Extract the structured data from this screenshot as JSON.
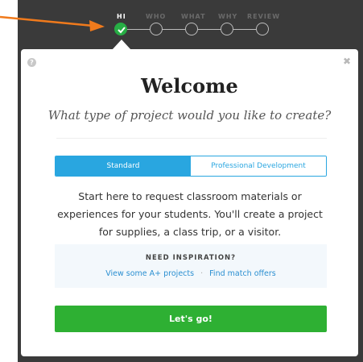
{
  "progress": {
    "steps": [
      {
        "label": "HI",
        "state": "completed"
      },
      {
        "label": "WHO",
        "state": "pending"
      },
      {
        "label": "WHAT",
        "state": "pending"
      },
      {
        "label": "WHY",
        "state": "pending"
      },
      {
        "label": "REVIEW",
        "state": "pending"
      }
    ]
  },
  "modal": {
    "title": "Welcome",
    "subtitle": "What type of project would you like to create?",
    "tabs": [
      {
        "label": "Standard",
        "selected": true
      },
      {
        "label": "Professional Development",
        "selected": false
      }
    ],
    "description": "Start here to request classroom materials or experiences for your students. You'll create a project for supplies, a class trip, or a visitor.",
    "inspiration": {
      "title": "NEED INSPIRATION?",
      "links": [
        "View some A+ projects",
        "Find match offers"
      ],
      "separator": "·"
    },
    "cta_label": "Let's go!",
    "help_icon": "?",
    "close_icon": "✖"
  },
  "colors": {
    "accent_blue": "#29a6e0",
    "success_green": "#2eb033",
    "annotation_arrow": "#f07a1c",
    "header_background": "#3a3a3a"
  },
  "icons": [
    "arrow-annotation",
    "check-icon",
    "help-icon",
    "close-icon"
  ]
}
